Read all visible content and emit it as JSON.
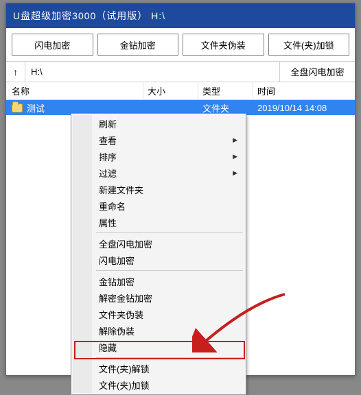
{
  "titlebar": {
    "title": "U盘超级加密3000（试用版）   H:\\"
  },
  "toolbar": {
    "btn1": "闪电加密",
    "btn2": "金钻加密",
    "btn3": "文件夹伪装",
    "btn4": "文件(夹)加锁"
  },
  "pathbar": {
    "up_icon": "↑",
    "path": "H:\\",
    "fulldisk": "全盘闪电加密"
  },
  "list_header": {
    "name": "名称",
    "size": "大小",
    "type": "类型",
    "time": "时间"
  },
  "files": [
    {
      "name": "测试",
      "size": "",
      "type": "文件夹",
      "time": "2019/10/14 14:08"
    }
  ],
  "context_menu": {
    "items": [
      {
        "label": "刷新",
        "sub": false
      },
      {
        "label": "查看",
        "sub": true
      },
      {
        "label": "排序",
        "sub": true
      },
      {
        "label": "过滤",
        "sub": true
      },
      {
        "label": "新建文件夹",
        "sub": false
      },
      {
        "label": "重命名",
        "sub": false
      },
      {
        "label": "属性",
        "sub": false
      },
      {
        "sep": true
      },
      {
        "label": "全盘闪电加密",
        "sub": false
      },
      {
        "label": "闪电加密",
        "sub": false
      },
      {
        "sep": true
      },
      {
        "label": "金钻加密",
        "sub": false
      },
      {
        "label": "解密金钻加密",
        "sub": false
      },
      {
        "label": "文件夹伪装",
        "sub": false
      },
      {
        "label": "解除伪装",
        "sub": false
      },
      {
        "label": "隐藏",
        "sub": false
      },
      {
        "sep": true
      },
      {
        "label": "文件(夹)解锁",
        "sub": false
      },
      {
        "label": "文件(夹)加锁",
        "sub": false
      }
    ]
  }
}
